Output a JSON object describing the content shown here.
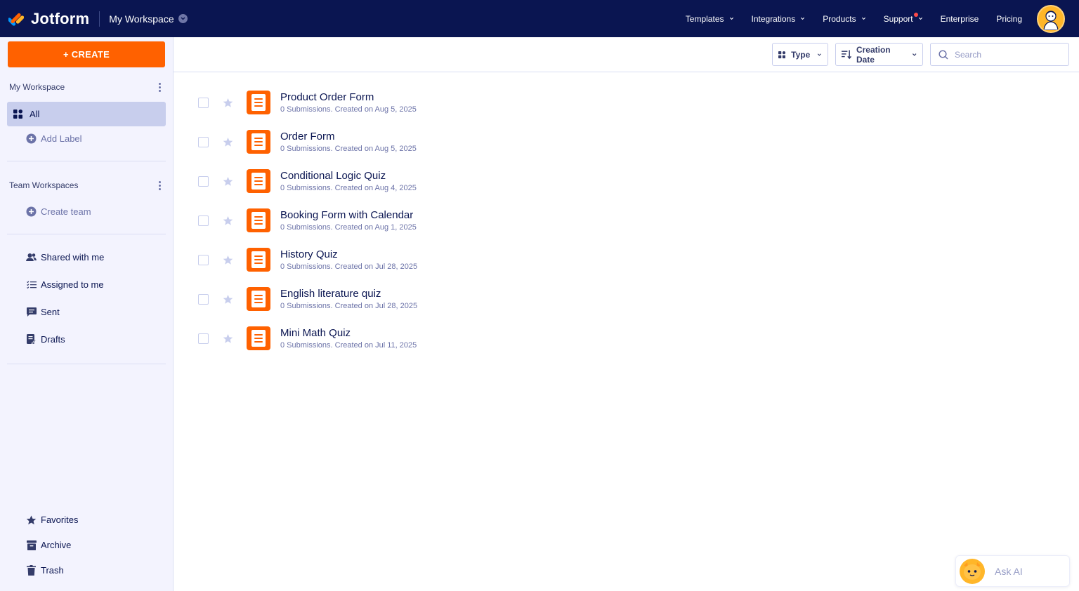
{
  "app": {
    "brand": "Jotform",
    "workspace_title": "My Workspace"
  },
  "nav": {
    "items": [
      "Templates",
      "Integrations",
      "Products",
      "Support",
      "Enterprise",
      "Pricing"
    ]
  },
  "sidebar": {
    "create_label": "+ CREATE",
    "my_workspace_heading": "My Workspace",
    "all_label": "All",
    "add_label": "Add Label",
    "team_workspaces_heading": "Team Workspaces",
    "create_team": "Create team",
    "shared_with_me": "Shared with me",
    "assigned_to_me": "Assigned to me",
    "sent": "Sent",
    "drafts": "Drafts",
    "favorites": "Favorites",
    "archive": "Archive",
    "trash": "Trash"
  },
  "toolbar": {
    "type_label": "Type",
    "sort_label": "Creation Date",
    "search_placeholder": "Search"
  },
  "forms": [
    {
      "title": "Product Order Form",
      "meta": "0 Submissions. Created on Aug 5, 2025"
    },
    {
      "title": "Order Form",
      "meta": "0 Submissions. Created on Aug 5, 2025"
    },
    {
      "title": "Conditional Logic Quiz",
      "meta": "0 Submissions. Created on Aug 4, 2025"
    },
    {
      "title": "Booking Form with Calendar",
      "meta": "0 Submissions. Created on Aug 1, 2025"
    },
    {
      "title": "History Quiz",
      "meta": "0 Submissions. Created on Jul 28, 2025"
    },
    {
      "title": "English literature quiz",
      "meta": "0 Submissions. Created on Jul 28, 2025"
    },
    {
      "title": "Mini Math Quiz",
      "meta": "0 Submissions. Created on Jul 11, 2025"
    }
  ],
  "ask_ai": {
    "label": "Ask AI"
  },
  "colors": {
    "navy": "#0a1551",
    "orange": "#ff6100",
    "sidebar_bg": "#f3f3fe",
    "selected_bg": "#c8ceed"
  },
  "icons": [
    "jotform-logo-icon",
    "chevron-down-icon",
    "avatar-icon",
    "grid-icon",
    "plus-circle-icon",
    "kebab-menu-icon",
    "users-icon",
    "checklist-icon",
    "message-icon",
    "draft-icon",
    "star-icon",
    "archive-icon",
    "trash-icon",
    "sort-icon",
    "search-icon",
    "form-icon",
    "ai-mascot-icon"
  ]
}
